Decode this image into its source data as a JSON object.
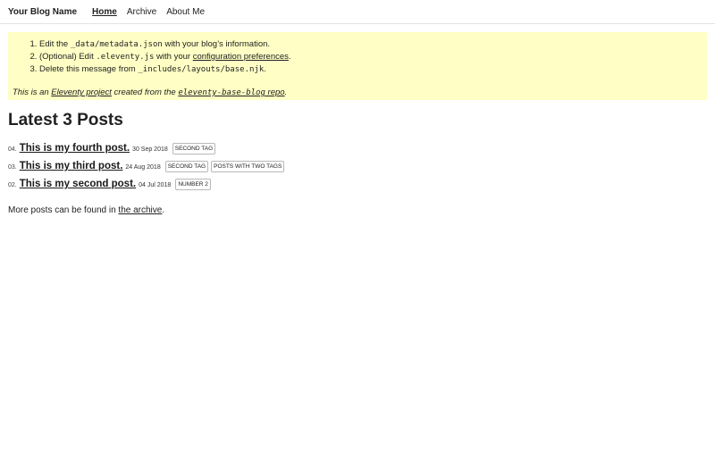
{
  "header": {
    "site_name": "Your Blog Name",
    "nav": [
      {
        "label": "Home",
        "active": true
      },
      {
        "label": "Archive",
        "active": false
      },
      {
        "label": "About Me",
        "active": false
      }
    ]
  },
  "warning": {
    "steps": [
      {
        "pre": "Edit the ",
        "code": "_data/metadata.json",
        "post": " with your blog’s information."
      },
      {
        "pre": "(Optional) Edit ",
        "code": ".eleventy.js",
        "post": " with your ",
        "link": "configuration preferences",
        "post2": "."
      },
      {
        "pre": "Delete this message from ",
        "code": "_includes/layouts/base.njk",
        "post": "."
      }
    ],
    "note": {
      "pre": "This is an ",
      "link1": "Eleventy project",
      "mid": " created from the ",
      "link2_code": "eleventy-base-blog",
      "link2_text": " repo",
      "post": "."
    }
  },
  "main": {
    "heading": "Latest 3 Posts",
    "posts": [
      {
        "num": "04.",
        "title": "This is my fourth post.",
        "date": "30 Sep 2018",
        "tags": [
          "second tag"
        ]
      },
      {
        "num": "03.",
        "title": "This is my third post.",
        "date": "24 Aug 2018",
        "tags": [
          "second tag",
          "posts with two tags"
        ]
      },
      {
        "num": "02.",
        "title": "This is my second post.",
        "date": "04 Jul 2018",
        "tags": [
          "number 2"
        ]
      }
    ],
    "more": {
      "pre": "More posts can be found in ",
      "link": "the archive",
      "post": "."
    }
  }
}
